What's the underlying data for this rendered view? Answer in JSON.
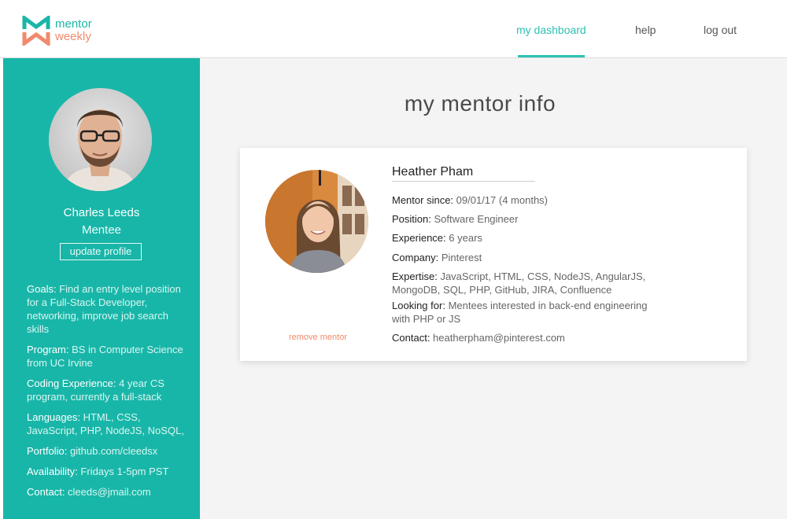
{
  "brand": {
    "line1": "mentor",
    "line2": "weekly",
    "colors": {
      "teal": "#1ab5a8",
      "coral": "#f08a6c"
    }
  },
  "nav": {
    "dashboard": "my dashboard",
    "help": "help",
    "logout": "log out"
  },
  "user": {
    "name": "Charles Leeds",
    "role": "Mentee",
    "update_label": "update profile",
    "details": [
      {
        "key": "Goals",
        "value": "Find an entry level position for a Full-Stack Developer, networking, improve job search skills"
      },
      {
        "key": "Program",
        "value": "BS in Computer Science from UC Irvine"
      },
      {
        "key": "Coding Experience",
        "value": "4 year CS program, currently a full-stack"
      },
      {
        "key": "Languages",
        "value": "HTML, CSS, JavaScript, PHP, NodeJS, NoSQL,"
      },
      {
        "key": "Portfolio",
        "value": "github.com/cleedsx"
      },
      {
        "key": "Availability",
        "value": "Fridays 1-5pm PST"
      },
      {
        "key": "Contact",
        "value": "cleeds@jmail.com"
      }
    ]
  },
  "page": {
    "title": "my mentor info"
  },
  "mentor": {
    "name": "Heather Pham",
    "remove_label": "remove mentor",
    "fields": [
      {
        "key": "Mentor since",
        "value": "09/01/17  (4 months)"
      },
      {
        "key": "Position",
        "value": "Software Engineer"
      },
      {
        "key": "Experience",
        "value": "6 years"
      },
      {
        "key": "Company",
        "value": "Pinterest"
      },
      {
        "key": "Expertise",
        "value": "JavaScript, HTML, CSS, NodeJS, AngularJS, MongoDB, SQL, PHP, GitHub, JIRA, Confluence"
      },
      {
        "key": "Looking for",
        "value": "Mentees interested in back-end engineering with PHP or JS"
      },
      {
        "key": "Contact",
        "value": "heatherpham@pinterest.com"
      }
    ]
  },
  "icons": {
    "logo": "mw-logo-icon"
  }
}
